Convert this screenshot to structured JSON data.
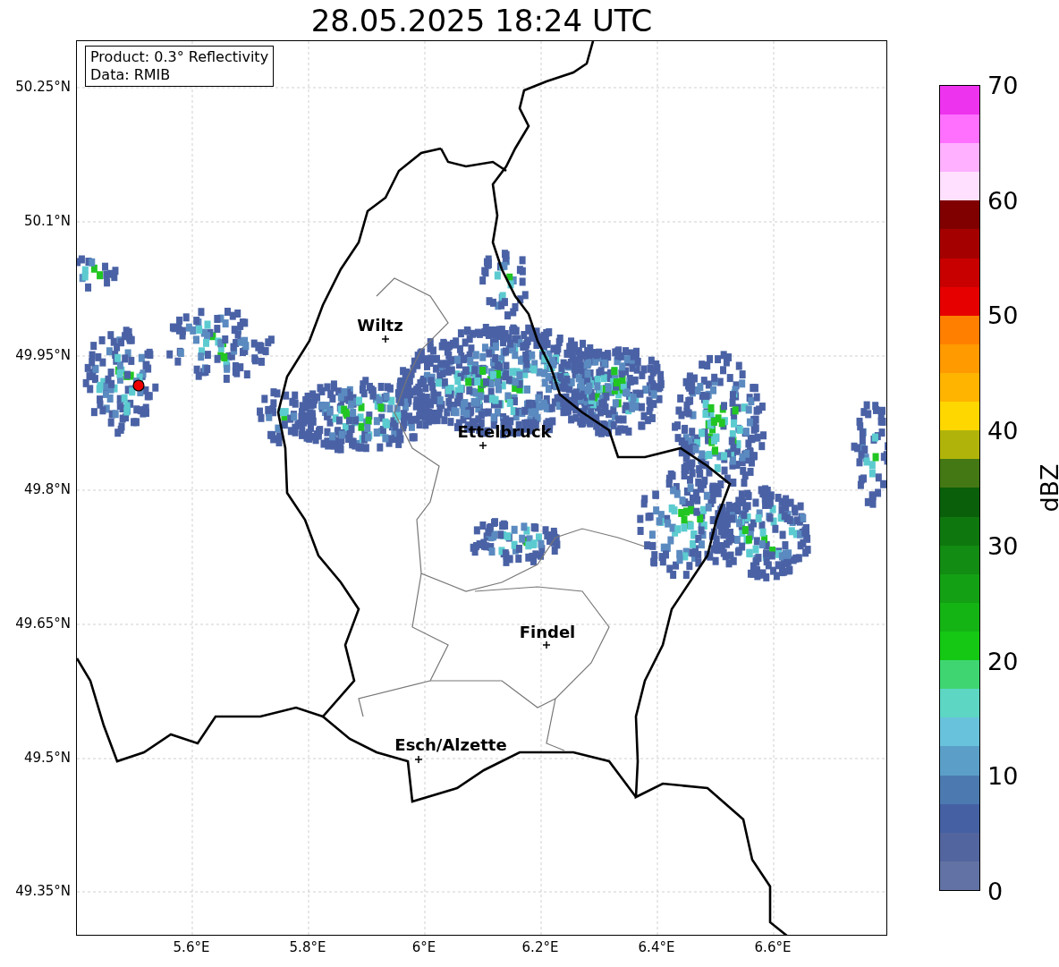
{
  "title": "28.05.2025 18:24 UTC",
  "info_box": {
    "lines": [
      "Product: 0.3° Reflectivity",
      "Data: RMIB"
    ]
  },
  "cities": [
    {
      "name": "Wiltz"
    },
    {
      "name": "Ettelbruck"
    },
    {
      "name": "Findel"
    },
    {
      "name": "Esch/Alzette"
    }
  ],
  "x_ticks": [
    "5.6°E",
    "5.8°E",
    "6°E",
    "6.2°E",
    "6.4°E",
    "6.6°E"
  ],
  "y_ticks": [
    "50.25°N",
    "50.1°N",
    "49.95°N",
    "49.8°N",
    "49.65°N",
    "49.5°N",
    "49.35°N"
  ],
  "colorbar": {
    "label": "dBZ",
    "ticks": [
      "70",
      "60",
      "50",
      "40",
      "30",
      "20",
      "10",
      "0"
    ],
    "bands": [
      {
        "color": "#6272a4"
      },
      {
        "color": "#52659e"
      },
      {
        "color": "#4561a3"
      },
      {
        "color": "#4c7ab0"
      },
      {
        "color": "#5b9fc8"
      },
      {
        "color": "#68c2dc"
      },
      {
        "color": "#5dd6c4"
      },
      {
        "color": "#3fd672"
      },
      {
        "color": "#14c814"
      },
      {
        "color": "#14b414"
      },
      {
        "color": "#14a014"
      },
      {
        "color": "#128c12"
      },
      {
        "color": "#0e780e"
      },
      {
        "color": "#0a600a"
      },
      {
        "color": "#447814"
      },
      {
        "color": "#b0b40a"
      },
      {
        "color": "#ffd700"
      },
      {
        "color": "#ffb400"
      },
      {
        "color": "#ff9a00"
      },
      {
        "color": "#ff7f00"
      },
      {
        "color": "#e60000"
      },
      {
        "color": "#c80000"
      },
      {
        "color": "#a50000"
      },
      {
        "color": "#800000"
      },
      {
        "color": "#ffe0ff"
      },
      {
        "color": "#ffb0ff"
      },
      {
        "color": "#ff70ff"
      },
      {
        "color": "#ee33ee"
      }
    ]
  }
}
